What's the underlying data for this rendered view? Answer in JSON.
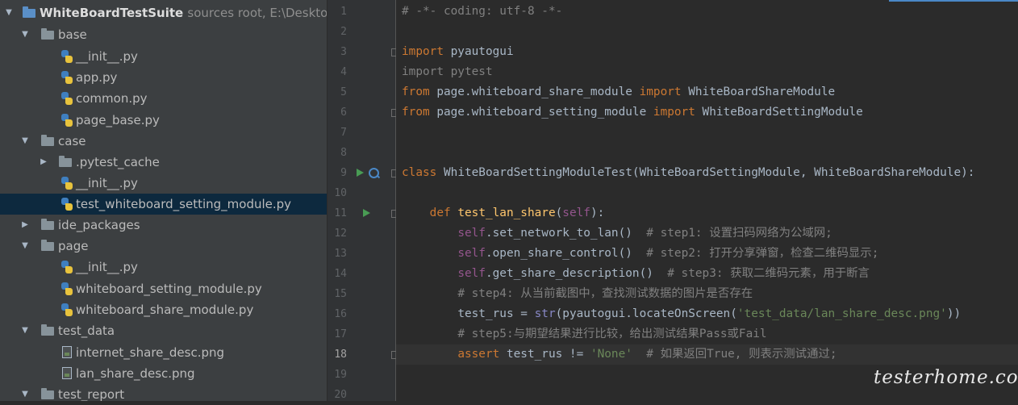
{
  "project_tree": {
    "root": {
      "name": "WhiteBoardTestSuite",
      "hint": "sources root, E:\\Desktop\\"
    },
    "items": [
      {
        "label": "base"
      },
      {
        "label": "__init__.py"
      },
      {
        "label": "app.py"
      },
      {
        "label": "common.py"
      },
      {
        "label": "page_base.py"
      },
      {
        "label": "case"
      },
      {
        "label": ".pytest_cache"
      },
      {
        "label": "__init__.py"
      },
      {
        "label": "test_whiteboard_setting_module.py"
      },
      {
        "label": "ide_packages"
      },
      {
        "label": "page"
      },
      {
        "label": "__init__.py"
      },
      {
        "label": "whiteboard_setting_module.py"
      },
      {
        "label": "whiteboard_share_module.py"
      },
      {
        "label": "test_data"
      },
      {
        "label": "internet_share_desc.png"
      },
      {
        "label": "lan_share_desc.png"
      },
      {
        "label": "test_report"
      }
    ]
  },
  "editor": {
    "line_numbers": [
      "1",
      "2",
      "3",
      "4",
      "5",
      "6",
      "7",
      "8",
      "9",
      "10",
      "11",
      "12",
      "13",
      "14",
      "15",
      "16",
      "17",
      "18",
      "19",
      "20"
    ],
    "current_line": "18",
    "code": {
      "l1": "# -*- coding: utf-8 -*-",
      "l3_kw": "import",
      "l3_rest": " pyautogui",
      "l4": "import pytest",
      "l5_kw1": "from",
      "l5_mid": " page.whiteboard_share_module ",
      "l5_kw2": "import",
      "l5_rest": " WhiteBoardShareModule",
      "l6_kw1": "from",
      "l6_mid": " page.whiteboard_setting_module ",
      "l6_kw2": "import",
      "l6_rest": " WhiteBoardSettingModule",
      "l9_kw": "class",
      "l9_rest": " WhiteBoardSettingModuleTest(WhiteBoardSettingModule, WhiteBoardShareModule):",
      "l11_indent": "    ",
      "l11_kw": "def",
      "l11_sp": " ",
      "l11_fn": "test_lan_share",
      "l11_open": "(",
      "l11_self": "self",
      "l11_close": "):",
      "l12_indent": "        ",
      "l12_self": "self",
      "l12_code": ".set_network_to_lan()  ",
      "l12_comment": "# step1: 设置扫码网络为公域网;",
      "l13_indent": "        ",
      "l13_self": "self",
      "l13_code": ".open_share_control()  ",
      "l13_comment": "# step2: 打开分享弹窗，检查二维码显示;",
      "l14_indent": "        ",
      "l14_self": "self",
      "l14_code": ".get_share_description()  ",
      "l14_comment": "# step3: 获取二维码元素，用于断言",
      "l15_indent": "        ",
      "l15_comment": "# step4: 从当前截图中，查找测试数据的图片是否存在",
      "l16_indent": "        ",
      "l16_a": "test_rus = ",
      "l16_b": "str",
      "l16_c": "(pyautogui.locateOnScreen(",
      "l16_s": "'test_data/lan_share_desc.png'",
      "l16_d": "))",
      "l17_indent": "        ",
      "l17_comment": "# step5:与期望结果进行比较，给出测试结果Pass或Fail",
      "l18_indent": "        ",
      "l18_kw": "assert",
      "l18_a": " test_rus != ",
      "l18_s": "'None'",
      "l18_sp": "  ",
      "l18_comment": "# 如果返回True, 则表示测试通过;"
    }
  },
  "watermark": "testerhome.com",
  "colors": {
    "keyword": "#cc7832",
    "comment": "#808080",
    "string": "#6a8759",
    "self": "#94558d",
    "function": "#ffc66d",
    "text": "#a9b7c6"
  }
}
